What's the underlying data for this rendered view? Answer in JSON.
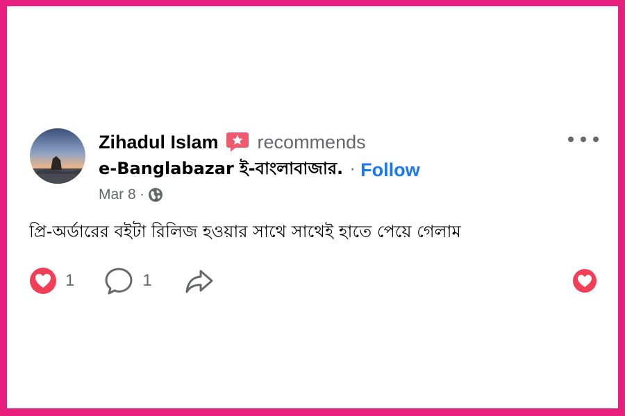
{
  "post": {
    "author": "Zihadul Islam",
    "action_text": "recommends",
    "page_name": "e-Banglabazar ই-বাংলাবাজার.",
    "separator": "·",
    "follow_label": "Follow",
    "date": "Mar 8",
    "meta_separator": "·",
    "body": "প্রি-অর্ডারের বইটা রিলিজ হওয়ার সাথে সাথেই হাতে পেয়ে গেলাম"
  },
  "actions": {
    "like_count": "1",
    "comment_count": "1"
  },
  "icons": {
    "recommend": "recommend-star-icon",
    "privacy": "globe-icon",
    "more": "more-options-icon",
    "like": "heart-reaction-icon",
    "comment": "comment-bubble-icon",
    "share": "share-arrow-icon",
    "react": "heart-react-icon"
  },
  "colors": {
    "frame": "#e81e7e",
    "link": "#1877f2",
    "heart": "#f33e58",
    "recommend_badge": "#f2586e",
    "secondary_text": "#65676b"
  }
}
